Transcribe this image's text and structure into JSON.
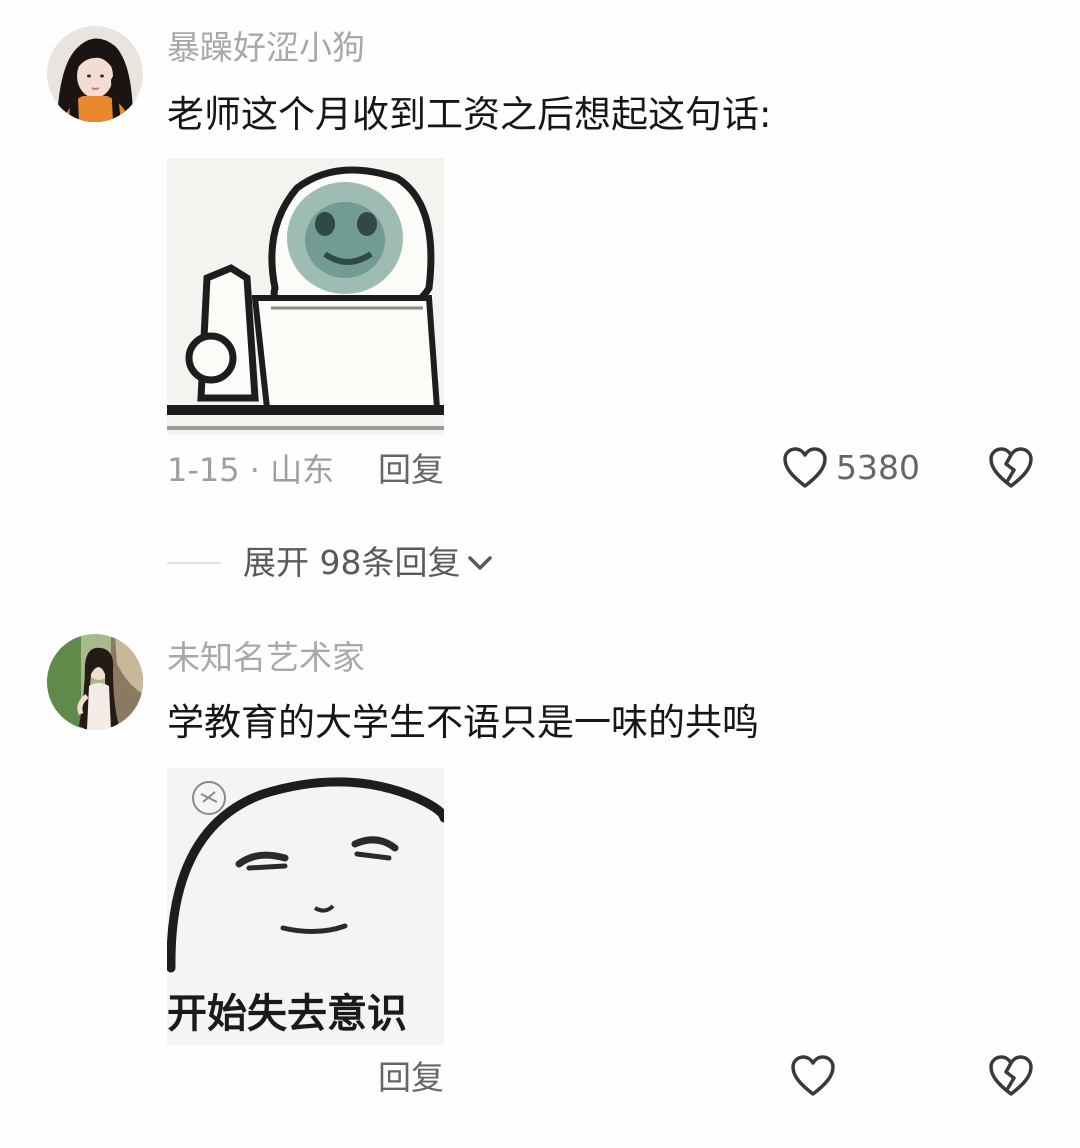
{
  "comments": [
    {
      "username": "暴躁好涩小狗",
      "text": "老师这个月收到工资之后想起这句话:",
      "meta": "1-15 · 山东",
      "reply_label": "回复",
      "like_count": "5380",
      "sticker_icon": "crying-meme-sticker",
      "expand_label": "展开 98条回复"
    },
    {
      "username": "未知名艺术家",
      "text": "学教育的大学生不语只是一味的共鸣",
      "reply_label": "回复",
      "like_count": "",
      "sticker_icon": "fainting-meme-sticker",
      "sticker_caption": "开始失去意识"
    }
  ],
  "icons": {
    "like": "heart-outline-icon",
    "dislike": "broken-heart-icon",
    "expand": "chevron-down-icon"
  },
  "colors": {
    "background": "#fefefe",
    "username": "#a8a8a8",
    "text": "#161616",
    "secondary": "#666666"
  }
}
